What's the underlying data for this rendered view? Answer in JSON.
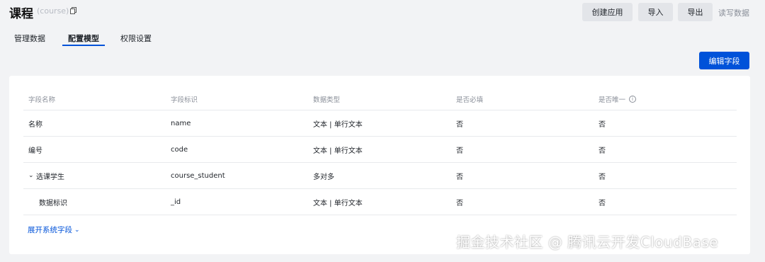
{
  "header": {
    "title": "课程",
    "subtitle": "(course)",
    "buttons": {
      "create": "创建应用",
      "import": "导入",
      "export": "导出"
    },
    "read_write": "读写数据"
  },
  "tabs": [
    "管理数据",
    "配置模型",
    "权限设置"
  ],
  "active_tab": "配置模型",
  "edit_button": "编辑字段",
  "table": {
    "columns": [
      "字段名称",
      "字段标识",
      "数据类型",
      "是否必填",
      "是否唯一"
    ],
    "rows": [
      {
        "name": "名称",
        "id": "name",
        "type": "文本 | 单行文本",
        "required": "否",
        "unique": "否"
      },
      {
        "name": "编号",
        "id": "code",
        "type": "文本 | 单行文本",
        "required": "否",
        "unique": "否"
      },
      {
        "name": "选课学生",
        "id": "course_student",
        "type": "多对多",
        "required": "否",
        "unique": "否"
      },
      {
        "name": "数据标识",
        "id": "_id",
        "type": "文本 | 单行文本",
        "required": "否",
        "unique": "否"
      }
    ]
  },
  "expand_link": "展开系统字段",
  "watermark": "掘金技术社区 @ 腾讯云开发CloudBase",
  "colors": {
    "primary": "#0052d9",
    "background": "#f2f3f5"
  },
  "icons": [
    "copy-icon",
    "info-icon",
    "chevron-down-icon"
  ]
}
